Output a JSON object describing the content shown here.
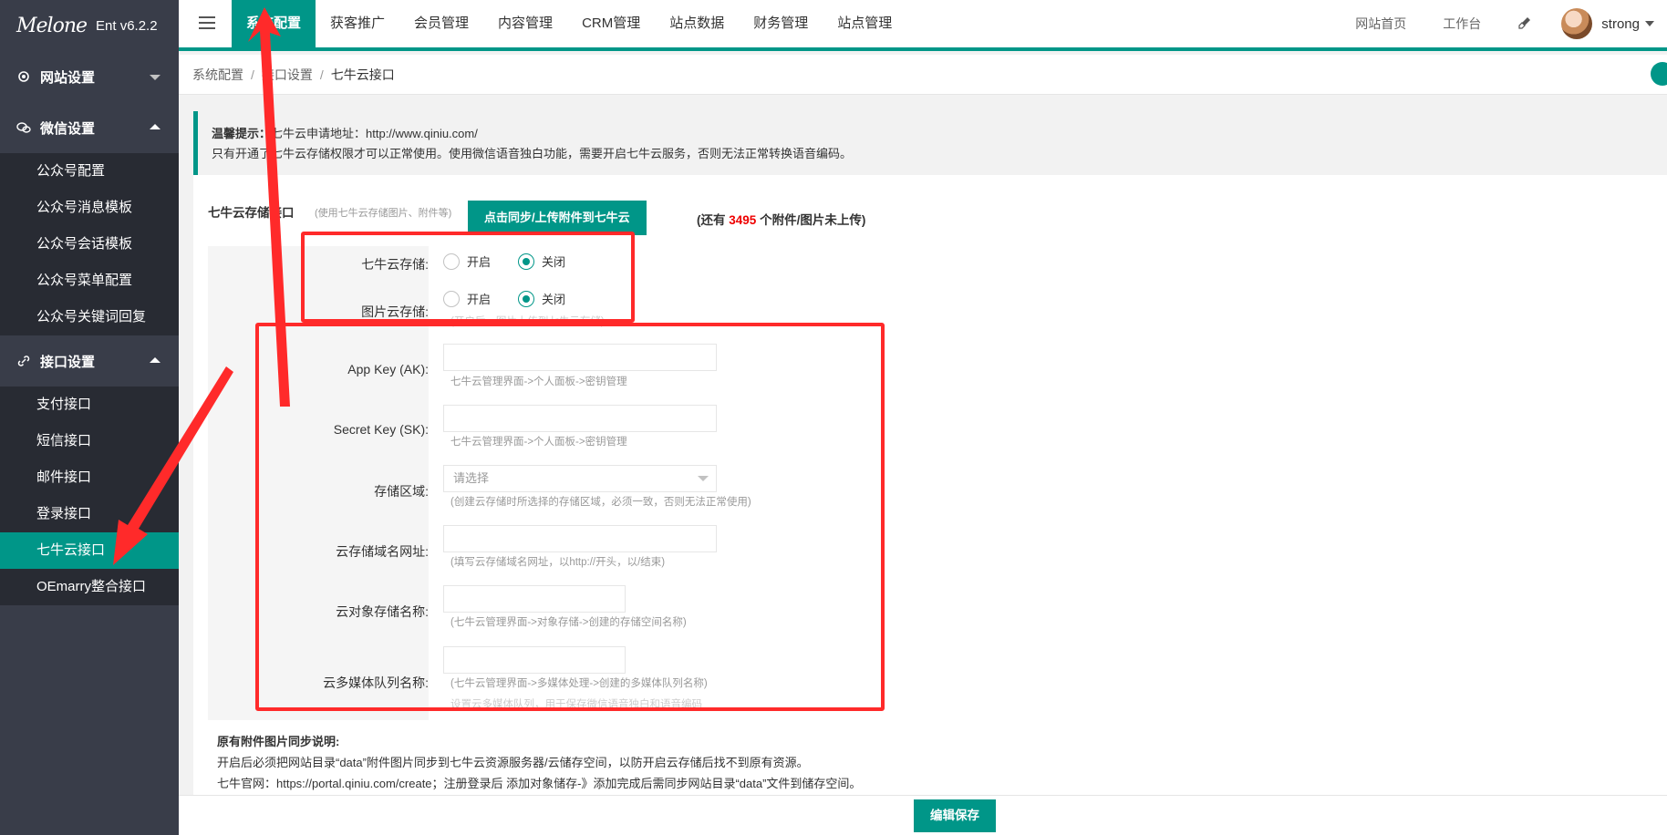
{
  "app": {
    "logo_text": "Melone",
    "version": "Ent v6.2.2"
  },
  "sidebar": {
    "groups": [
      {
        "label": "网站设置",
        "expanded": false,
        "items": []
      },
      {
        "label": "微信设置",
        "expanded": true,
        "items": [
          "公众号配置",
          "公众号消息模板",
          "公众号会话模板",
          "公众号菜单配置",
          "公众号关键词回复"
        ]
      },
      {
        "label": "接口设置",
        "expanded": true,
        "items": [
          "支付接口",
          "短信接口",
          "邮件接口",
          "登录接口",
          "七牛云接口",
          "OEmarry整合接口"
        ],
        "active_item": "七牛云接口"
      }
    ]
  },
  "topnav": {
    "items": [
      "系统配置",
      "获客推广",
      "会员管理",
      "内容管理",
      "CRM管理",
      "站点数据",
      "财务管理",
      "站点管理"
    ],
    "active": "系统配置",
    "right": {
      "home": "网站首页",
      "workbench": "工作台",
      "username": "strong"
    }
  },
  "breadcrumb": [
    "系统配置",
    "接口设置",
    "七牛云接口"
  ],
  "tip": {
    "label": "温馨提示：",
    "line1": "七牛云申请地址：http://www.qiniu.com/",
    "line2": "只有开通了七牛云存储权限才可以正常使用。使用微信语音独白功能，需要开启七牛云服务，否则无法正常转换语音编码。"
  },
  "form": {
    "title": "七牛云存储接口",
    "subtitle": "(使用七牛云存储图片、附件等)",
    "sync_button": "点击同步/上传附件到七牛云",
    "remain_prefix": "(还有",
    "remain_count": "3495",
    "remain_suffix": "个附件/图片未上传)",
    "radio_on": "开启",
    "radio_off": "关闭",
    "storage_label": "七牛云存储:",
    "image_label": "图片云存储:",
    "image_hint": "(开启后，图片上传到七牛云存储)",
    "ak_label": "App Key (AK):",
    "ak_hint": "七牛云管理界面->个人面板->密钥管理",
    "sk_label": "Secret Key (SK):",
    "sk_hint": "七牛云管理界面->个人面板->密钥管理",
    "region_label": "存储区域:",
    "region_placeholder": "请选择",
    "region_hint": "(创建云存储时所选择的存储区域，必须一致，否则无法正常使用)",
    "domain_label": "云存储域名网址:",
    "domain_hint": "(填写云存储域名网址，以http://开头，以/结束)",
    "bucket_label": "云对象存储名称:",
    "bucket_hint": "(七牛云管理界面->对象存储->创建的存储空间名称)",
    "queue_label": "云多媒体队列名称:",
    "queue_hint": "(七牛云管理界面->多媒体处理->创建的多媒体队列名称)",
    "queue_hint2": "设置云多媒体队列，用于保存微信语音独白和语音编码"
  },
  "notes": {
    "title": "原有附件图片同步说明:",
    "line1": "开启后必须把网站目录“data”附件图片同步到七牛云资源服务器/云储存空间，以防开启云存储后找不到原有资源。",
    "line2": "七牛官网：https://portal.qiniu.com/create；注册登录后 添加对象储存-》添加完成后需同步网站目录“data”文件到储存空间。"
  },
  "save_button": "编辑保存",
  "colors": {
    "accent": "#009688",
    "sidebar_bg": "#393D49",
    "sidebar_sub_bg": "#282B33",
    "annotation": "#ff2a2a"
  }
}
